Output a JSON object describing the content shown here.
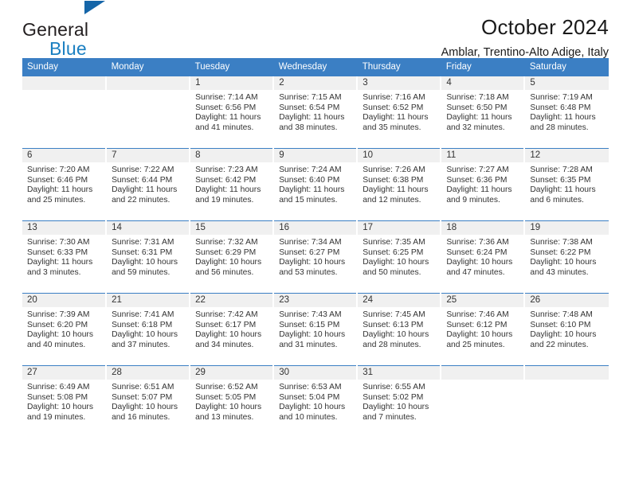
{
  "brand": {
    "line1": "General",
    "line2": "Blue",
    "flag_color": "#1565a8",
    "text_color": "#231f20",
    "accent_color": "#1a7fc1"
  },
  "header": {
    "title": "October 2024",
    "location": "Amblar, Trentino-Alto Adige, Italy"
  },
  "theme": {
    "header_band": "#3b7fc4",
    "daynum_strip": "#f0f0f0",
    "grid_line": "#3b7fc4",
    "text": "#333333"
  },
  "weekday_headers": [
    "Sunday",
    "Monday",
    "Tuesday",
    "Wednesday",
    "Thursday",
    "Friday",
    "Saturday"
  ],
  "labels": {
    "sunrise_prefix": "Sunrise:",
    "sunset_prefix": "Sunset:",
    "daylight_prefix": "Daylight:"
  },
  "weeks": [
    [
      {
        "day": "",
        "sunrise": "",
        "sunset": "",
        "daylight": "",
        "empty": true
      },
      {
        "day": "",
        "sunrise": "",
        "sunset": "",
        "daylight": "",
        "empty": true
      },
      {
        "day": "1",
        "sunrise": "Sunrise: 7:14 AM",
        "sunset": "Sunset: 6:56 PM",
        "daylight": "Daylight: 11 hours and 41 minutes."
      },
      {
        "day": "2",
        "sunrise": "Sunrise: 7:15 AM",
        "sunset": "Sunset: 6:54 PM",
        "daylight": "Daylight: 11 hours and 38 minutes."
      },
      {
        "day": "3",
        "sunrise": "Sunrise: 7:16 AM",
        "sunset": "Sunset: 6:52 PM",
        "daylight": "Daylight: 11 hours and 35 minutes."
      },
      {
        "day": "4",
        "sunrise": "Sunrise: 7:18 AM",
        "sunset": "Sunset: 6:50 PM",
        "daylight": "Daylight: 11 hours and 32 minutes."
      },
      {
        "day": "5",
        "sunrise": "Sunrise: 7:19 AM",
        "sunset": "Sunset: 6:48 PM",
        "daylight": "Daylight: 11 hours and 28 minutes."
      }
    ],
    [
      {
        "day": "6",
        "sunrise": "Sunrise: 7:20 AM",
        "sunset": "Sunset: 6:46 PM",
        "daylight": "Daylight: 11 hours and 25 minutes."
      },
      {
        "day": "7",
        "sunrise": "Sunrise: 7:22 AM",
        "sunset": "Sunset: 6:44 PM",
        "daylight": "Daylight: 11 hours and 22 minutes."
      },
      {
        "day": "8",
        "sunrise": "Sunrise: 7:23 AM",
        "sunset": "Sunset: 6:42 PM",
        "daylight": "Daylight: 11 hours and 19 minutes."
      },
      {
        "day": "9",
        "sunrise": "Sunrise: 7:24 AM",
        "sunset": "Sunset: 6:40 PM",
        "daylight": "Daylight: 11 hours and 15 minutes."
      },
      {
        "day": "10",
        "sunrise": "Sunrise: 7:26 AM",
        "sunset": "Sunset: 6:38 PM",
        "daylight": "Daylight: 11 hours and 12 minutes."
      },
      {
        "day": "11",
        "sunrise": "Sunrise: 7:27 AM",
        "sunset": "Sunset: 6:36 PM",
        "daylight": "Daylight: 11 hours and 9 minutes."
      },
      {
        "day": "12",
        "sunrise": "Sunrise: 7:28 AM",
        "sunset": "Sunset: 6:35 PM",
        "daylight": "Daylight: 11 hours and 6 minutes."
      }
    ],
    [
      {
        "day": "13",
        "sunrise": "Sunrise: 7:30 AM",
        "sunset": "Sunset: 6:33 PM",
        "daylight": "Daylight: 11 hours and 3 minutes."
      },
      {
        "day": "14",
        "sunrise": "Sunrise: 7:31 AM",
        "sunset": "Sunset: 6:31 PM",
        "daylight": "Daylight: 10 hours and 59 minutes."
      },
      {
        "day": "15",
        "sunrise": "Sunrise: 7:32 AM",
        "sunset": "Sunset: 6:29 PM",
        "daylight": "Daylight: 10 hours and 56 minutes."
      },
      {
        "day": "16",
        "sunrise": "Sunrise: 7:34 AM",
        "sunset": "Sunset: 6:27 PM",
        "daylight": "Daylight: 10 hours and 53 minutes."
      },
      {
        "day": "17",
        "sunrise": "Sunrise: 7:35 AM",
        "sunset": "Sunset: 6:25 PM",
        "daylight": "Daylight: 10 hours and 50 minutes."
      },
      {
        "day": "18",
        "sunrise": "Sunrise: 7:36 AM",
        "sunset": "Sunset: 6:24 PM",
        "daylight": "Daylight: 10 hours and 47 minutes."
      },
      {
        "day": "19",
        "sunrise": "Sunrise: 7:38 AM",
        "sunset": "Sunset: 6:22 PM",
        "daylight": "Daylight: 10 hours and 43 minutes."
      }
    ],
    [
      {
        "day": "20",
        "sunrise": "Sunrise: 7:39 AM",
        "sunset": "Sunset: 6:20 PM",
        "daylight": "Daylight: 10 hours and 40 minutes."
      },
      {
        "day": "21",
        "sunrise": "Sunrise: 7:41 AM",
        "sunset": "Sunset: 6:18 PM",
        "daylight": "Daylight: 10 hours and 37 minutes."
      },
      {
        "day": "22",
        "sunrise": "Sunrise: 7:42 AM",
        "sunset": "Sunset: 6:17 PM",
        "daylight": "Daylight: 10 hours and 34 minutes."
      },
      {
        "day": "23",
        "sunrise": "Sunrise: 7:43 AM",
        "sunset": "Sunset: 6:15 PM",
        "daylight": "Daylight: 10 hours and 31 minutes."
      },
      {
        "day": "24",
        "sunrise": "Sunrise: 7:45 AM",
        "sunset": "Sunset: 6:13 PM",
        "daylight": "Daylight: 10 hours and 28 minutes."
      },
      {
        "day": "25",
        "sunrise": "Sunrise: 7:46 AM",
        "sunset": "Sunset: 6:12 PM",
        "daylight": "Daylight: 10 hours and 25 minutes."
      },
      {
        "day": "26",
        "sunrise": "Sunrise: 7:48 AM",
        "sunset": "Sunset: 6:10 PM",
        "daylight": "Daylight: 10 hours and 22 minutes."
      }
    ],
    [
      {
        "day": "27",
        "sunrise": "Sunrise: 6:49 AM",
        "sunset": "Sunset: 5:08 PM",
        "daylight": "Daylight: 10 hours and 19 minutes."
      },
      {
        "day": "28",
        "sunrise": "Sunrise: 6:51 AM",
        "sunset": "Sunset: 5:07 PM",
        "daylight": "Daylight: 10 hours and 16 minutes."
      },
      {
        "day": "29",
        "sunrise": "Sunrise: 6:52 AM",
        "sunset": "Sunset: 5:05 PM",
        "daylight": "Daylight: 10 hours and 13 minutes."
      },
      {
        "day": "30",
        "sunrise": "Sunrise: 6:53 AM",
        "sunset": "Sunset: 5:04 PM",
        "daylight": "Daylight: 10 hours and 10 minutes."
      },
      {
        "day": "31",
        "sunrise": "Sunrise: 6:55 AM",
        "sunset": "Sunset: 5:02 PM",
        "daylight": "Daylight: 10 hours and 7 minutes."
      },
      {
        "day": "",
        "sunrise": "",
        "sunset": "",
        "daylight": "",
        "empty": true
      },
      {
        "day": "",
        "sunrise": "",
        "sunset": "",
        "daylight": "",
        "empty": true
      }
    ]
  ]
}
